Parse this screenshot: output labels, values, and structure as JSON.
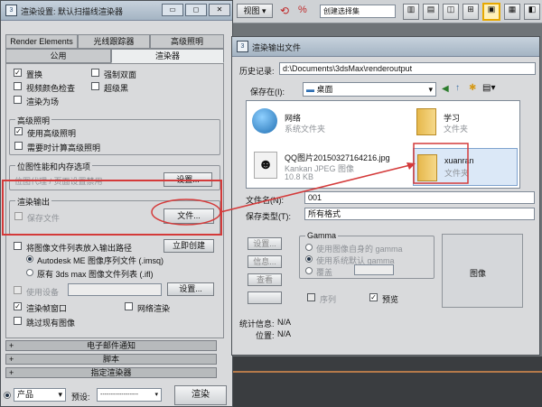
{
  "top_toolbar": {
    "view_label": "视图",
    "selection_set": "创建选择集"
  },
  "render_setup": {
    "title": "渲染设置: 默认扫描线渲染器",
    "tabs_row1": [
      "Render Elements",
      "光线跟踪器",
      "高级照明"
    ],
    "tabs_row2": [
      "公用",
      "渲染器"
    ],
    "options": [
      "置换",
      "视频颜色检查",
      "渲染为场",
      "强制双面",
      "超级黑"
    ],
    "advanced_lighting": {
      "title": "高级照明",
      "use": "使用高级照明",
      "compute": "需要时计算高级照明"
    },
    "bitmap": {
      "title": "位图性能和内存选项",
      "value": "位图代理 / 页面设置禁用",
      "button": "设置..."
    },
    "render_output": {
      "title": "渲染输出",
      "save_file": "保存文件",
      "file_button": "文件..."
    },
    "sequence": {
      "put_image_list": "将图像文件列表放入输出路径",
      "create_now": "立即创建",
      "autodesk": "Autodesk ME 图像序列文件 (.imsq)",
      "legacy": "原有 3ds max 图像文件列表 (.ifl)"
    },
    "device": {
      "use_device": "使用设备",
      "button": "设置..."
    },
    "frame_window": "渲染帧窗口",
    "net_render": "网络渲染",
    "skip_existing": "跳过现有图像",
    "rollouts": [
      "电子邮件通知",
      "脚本",
      "指定渲染器"
    ],
    "footer": {
      "product_label": "产品",
      "product_value": "产品",
      "preset_label": "预设:",
      "preset_value": "------------------",
      "render_button": "渲染"
    }
  },
  "dialog": {
    "title": "渲染输出文件",
    "history_label": "历史记录:",
    "history_value": "d:\\Documents\\3dsMax\\renderoutput",
    "save_in_label": "保存在(I):",
    "save_in_value": "桌面",
    "files": [
      {
        "name": "网络",
        "type": "系统文件夹"
      },
      {
        "name": "学习",
        "type": "文件夹"
      },
      {
        "name": "QQ图片20150327164216.jpg",
        "type": "Kankan JPEG 图像",
        "size": "10.8 KB"
      },
      {
        "name": "xuanran",
        "type": "文件夹"
      }
    ],
    "filename_label": "文件名(N):",
    "filename_value": "001",
    "savetype_label": "保存类型(T):",
    "savetype_value": "所有格式",
    "left_buttons": [
      "设置...",
      "信息...",
      "查看"
    ],
    "gamma": {
      "title": "Gamma",
      "opt1": "使用图像自身的 gamma",
      "opt2": "使用系统默认 gamma",
      "opt3": "覆盖"
    },
    "sequence": "序列",
    "preview": "预览",
    "image_label": "图像",
    "stats_label": "统计信息:",
    "stats_value": "N/A",
    "location_label": "位置:",
    "location_value": "N/A"
  },
  "colors": {
    "annotation": "#d43a3a",
    "title_gradient": "#a4b4c3"
  }
}
